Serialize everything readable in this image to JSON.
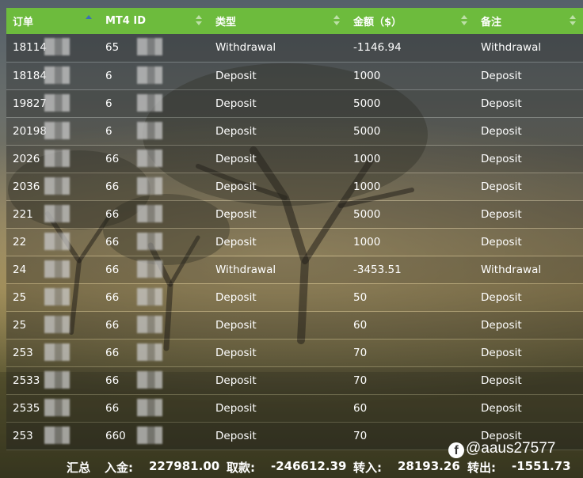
{
  "table": {
    "headers": [
      {
        "label": "订单",
        "sort": "asc"
      },
      {
        "label": "MT4 ID",
        "sort": "none"
      },
      {
        "label": "类型",
        "sort": "none"
      },
      {
        "label": "金额（$）",
        "sort": "none"
      },
      {
        "label": "备注",
        "sort": "none"
      }
    ],
    "rows": [
      {
        "order": "18114",
        "mt4": "65",
        "type": "Withdrawal",
        "amount": "-1146.94",
        "note": "Withdrawal"
      },
      {
        "order": "18184",
        "mt4": "6",
        "type": "Deposit",
        "amount": "1000",
        "note": "Deposit"
      },
      {
        "order": "19827",
        "mt4": "6",
        "type": "Deposit",
        "amount": "5000",
        "note": "Deposit"
      },
      {
        "order": "20198",
        "mt4": "6",
        "type": "Deposit",
        "amount": "5000",
        "note": "Deposit"
      },
      {
        "order": "2026",
        "mt4": "66",
        "type": "Deposit",
        "amount": "1000",
        "note": "Deposit"
      },
      {
        "order": "2036",
        "mt4": "66",
        "type": "Deposit",
        "amount": "1000",
        "note": "Deposit"
      },
      {
        "order": "221",
        "mt4": "66",
        "type": "Deposit",
        "amount": "5000",
        "note": "Deposit"
      },
      {
        "order": "22",
        "mt4": "66",
        "type": "Deposit",
        "amount": "1000",
        "note": "Deposit"
      },
      {
        "order": "24",
        "mt4": "66",
        "type": "Withdrawal",
        "amount": "-3453.51",
        "note": "Withdrawal"
      },
      {
        "order": "25",
        "mt4": "66",
        "type": "Deposit",
        "amount": "50",
        "note": "Deposit"
      },
      {
        "order": "25",
        "mt4": "66",
        "type": "Deposit",
        "amount": "60",
        "note": "Deposit"
      },
      {
        "order": "253",
        "mt4": "66",
        "type": "Deposit",
        "amount": "70",
        "note": "Deposit"
      },
      {
        "order": "2533",
        "mt4": "66",
        "type": "Deposit",
        "amount": "70",
        "note": "Deposit"
      },
      {
        "order": "2535",
        "mt4": "66",
        "type": "Deposit",
        "amount": "60",
        "note": "Deposit"
      },
      {
        "order": "253",
        "mt4": "660",
        "type": "Deposit",
        "amount": "70",
        "note": "Deposit"
      }
    ]
  },
  "summary": {
    "label": "汇总",
    "deposit_label": "入金:",
    "deposit_value": "227981.00",
    "withdraw_label": "取款:",
    "withdraw_value": "-246612.39",
    "transfer_in_label": "转入:",
    "transfer_in_value": "28193.26",
    "transfer_out_label": "转出:",
    "transfer_out_value": "-1551.73"
  },
  "watermark": {
    "icon": "facebook-icon",
    "text": "@aaus27577"
  },
  "colors": {
    "header_bg": "#6dbb3d",
    "sort_active": "#3d6fb4"
  }
}
